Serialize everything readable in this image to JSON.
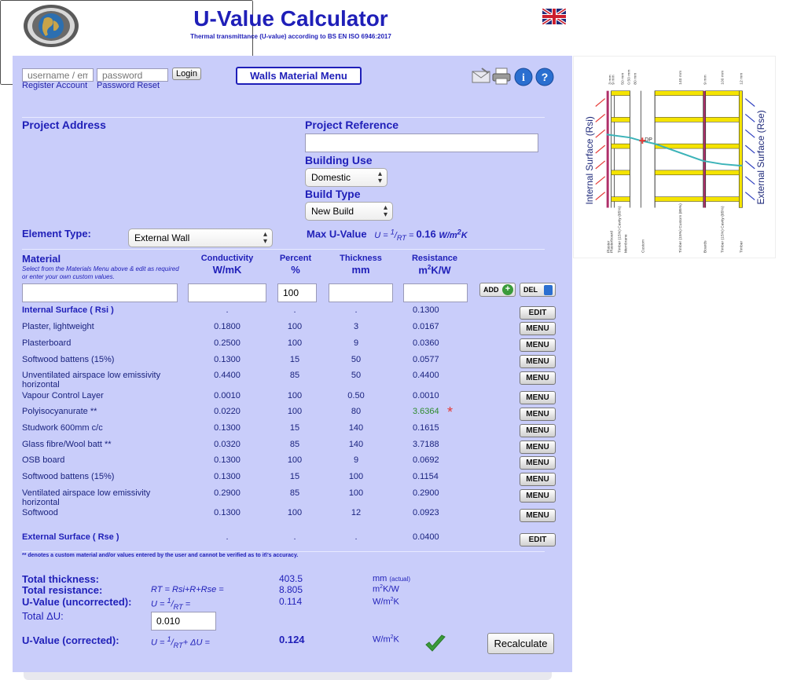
{
  "header": {
    "title": "U-Value Calculator",
    "subtitle": "Thermal transmittance (U-value) according to BS EN ISO 6946:2017"
  },
  "login": {
    "username_placeholder": "username / email",
    "password_placeholder": "password",
    "login_label": "Login",
    "register_label": "Register Account",
    "reset_label": "Password Reset"
  },
  "menu_label": "Walls Material Menu",
  "project": {
    "address_label": "Project Address",
    "reference_label": "Project Reference",
    "building_use_label": "Building Use",
    "building_use_value": "Domestic",
    "build_type_label": "Build Type",
    "build_type_value": "New Build"
  },
  "element": {
    "label": "Element Type:",
    "value": "External Wall",
    "max_label": "Max U-Value",
    "max_formula_pre": "U = ",
    "max_formula_num": "1",
    "max_formula_den": "RT",
    "max_formula_eq": " = ",
    "max_value": "0.16",
    "max_unit_a": "W/m",
    "max_unit_sup": "2",
    "max_unit_b": "K"
  },
  "columns": {
    "material": "Material",
    "material_help": "Select from the Materials Menu above & edit as required or enter your own custom values.",
    "conductivity": "Conductivity",
    "conductivity_unit": "W/mK",
    "percent": "Percent",
    "percent_unit": "%",
    "thickness": "Thickness",
    "thickness_unit": "mm",
    "resistance": "Resistance",
    "resistance_unit_a": "m",
    "resistance_unit_sup": "2",
    "resistance_unit_b": "K/W"
  },
  "entry": {
    "percent_value": "100",
    "add_label": "ADD",
    "del_label": "DEL"
  },
  "rows": [
    {
      "name": "Internal Surface ( Rsi )",
      "bold": true,
      "cond": ".",
      "pct": ".",
      "thk": ".",
      "res": "0.1300",
      "btn": "EDIT"
    },
    {
      "name": "Plaster, lightweight",
      "cond": "0.1800",
      "pct": "100",
      "thk": "3",
      "res": "0.0167",
      "btn": "MENU"
    },
    {
      "name": "Plasterboard",
      "cond": "0.2500",
      "pct": "100",
      "thk": "9",
      "res": "0.0360",
      "btn": "MENU"
    },
    {
      "name": "Softwood battens (15%)",
      "cond": "0.1300",
      "pct": "15",
      "thk": "50",
      "res": "0.0577",
      "btn": "MENU"
    },
    {
      "name": "Unventilated airspace low emissivity horizontal",
      "cond": "0.4400",
      "pct": "85",
      "thk": "50",
      "res": "0.4400",
      "btn": "MENU"
    },
    {
      "name": "Vapour Control Layer",
      "cond": "0.0010",
      "pct": "100",
      "thk": "0.50",
      "res": "0.0010",
      "btn": "MENU"
    },
    {
      "name": "Polyisocyanurate **",
      "cond": "0.0220",
      "pct": "100",
      "thk": "80",
      "res": "3.6364",
      "green": true,
      "btn": "MENU"
    },
    {
      "name": "Studwork 600mm c/c",
      "cond": "0.1300",
      "pct": "15",
      "thk": "140",
      "res": "0.1615",
      "btn": "MENU"
    },
    {
      "name": "Glass fibre/Wool batt **",
      "cond": "0.0320",
      "pct": "85",
      "thk": "140",
      "res": "3.7188",
      "btn": "MENU"
    },
    {
      "name": "OSB board",
      "cond": "0.1300",
      "pct": "100",
      "thk": "9",
      "res": "0.0692",
      "btn": "MENU"
    },
    {
      "name": "Softwood battens (15%)",
      "cond": "0.1300",
      "pct": "15",
      "thk": "100",
      "res": "0.1154",
      "btn": "MENU"
    },
    {
      "name": "Ventilated airspace low emissivity horizontal",
      "cond": "0.2900",
      "pct": "85",
      "thk": "100",
      "res": "0.2900",
      "btn": "MENU"
    },
    {
      "name": "Softwood",
      "cond": "0.1300",
      "pct": "100",
      "thk": "12",
      "res": "0.0923",
      "btn": "MENU"
    },
    {
      "name": "External Surface ( Rse )",
      "bold": true,
      "cond": ".",
      "pct": ".",
      "thk": ".",
      "res": "0.0400",
      "btn": "EDIT"
    }
  ],
  "note": "** denotes a custom material and/or values entered by the user and cannot be verified as to it\\'s accuracy.",
  "totals": {
    "thickness_label": "Total thickness:",
    "thickness_value": "403.5",
    "thickness_unit": "mm",
    "thickness_unit_note": "(actual)",
    "resistance_label": "Total resistance:",
    "resistance_formula": "RT = Rsi+R+Rse =",
    "resistance_value": "8.805",
    "resistance_unit_a": "m",
    "resistance_unit_sup": "2",
    "resistance_unit_b": "K/W",
    "uncorr_label": "U-Value (uncorrected):",
    "uncorr_formula_pre": "U = ",
    "uncorr_formula_num": "1",
    "uncorr_formula_den": "RT",
    "uncorr_formula_post": " =",
    "uncorr_value": "0.114",
    "u_unit_a": "W/m",
    "u_unit_sup": "2",
    "u_unit_b": "K",
    "delta_label": "Total ΔU:",
    "delta_value": "0.010",
    "corr_label": "U-Value (corrected):",
    "corr_formula_pre": "U = ",
    "corr_formula_num": "1",
    "corr_formula_den": "RT",
    "corr_formula_post": "+ ΔU =",
    "corr_value": "0.124",
    "recalc_label": "Recalculate"
  },
  "diagram": {
    "internal_label": "Internal Surface (Rsi)",
    "external_label": "External Surface (Rse)",
    "dp_label": "DP",
    "top_labels": [
      "3 mm",
      "9 mm",
      "50 mm",
      "0.50 mm",
      "80 mm",
      "140 mm",
      "9 mm",
      "100 mm",
      "12 mm"
    ],
    "bottom_labels": [
      "Plaster",
      "Plasterboard",
      "Timber (15%) Cavity (85%)",
      "Membrane",
      "Custom",
      "Timber (15%) Custom (85%)",
      "Boards",
      "Timber (15%) Cavity (85%)",
      "Timber"
    ],
    "colors": {
      "stud": "#f5e400",
      "plaster": "#b0306a",
      "line": "#3bb3b8",
      "arrow": "#e53935",
      "arrow_ext": "#3040c0"
    }
  }
}
